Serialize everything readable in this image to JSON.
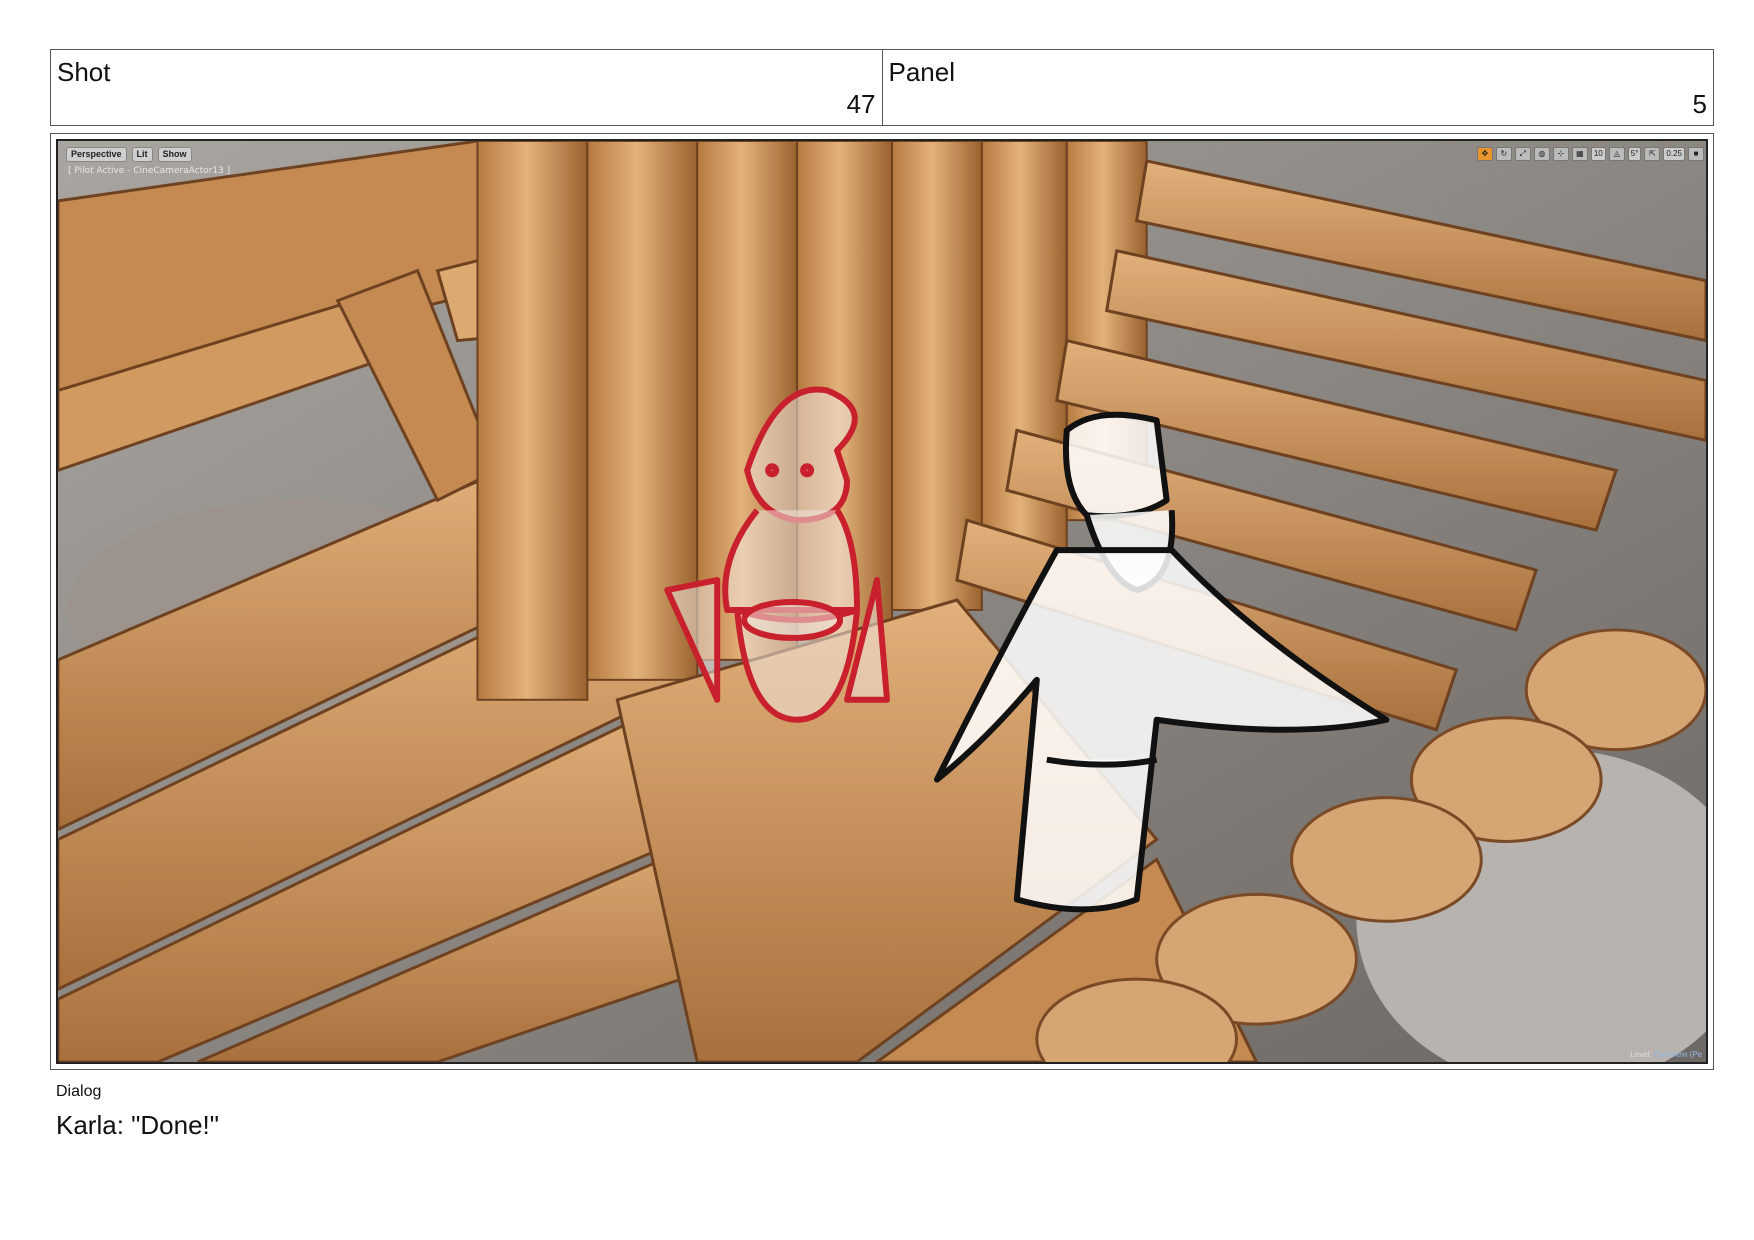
{
  "header": {
    "shot_label": "Shot",
    "shot_value": "47",
    "panel_label": "Panel",
    "panel_value": "5"
  },
  "viewport": {
    "toolbar_buttons": [
      "Perspective",
      "Lit",
      "Show"
    ],
    "pilot_text": "[ Pilot Active - CineCameraActor13 ]",
    "toolbar_right_values": [
      "10",
      "5°",
      "0.25"
    ],
    "level_label": "Level:",
    "level_name": "Overview (Pe"
  },
  "dialog": {
    "label": "Dialog",
    "text": "Karla: \"Done!\""
  },
  "colors": {
    "wood_light": "#d9a56b",
    "wood_dark": "#8a5428",
    "rock": "#8e8a86",
    "sketch_red": "#c8202c",
    "sketch_black": "#111111"
  }
}
